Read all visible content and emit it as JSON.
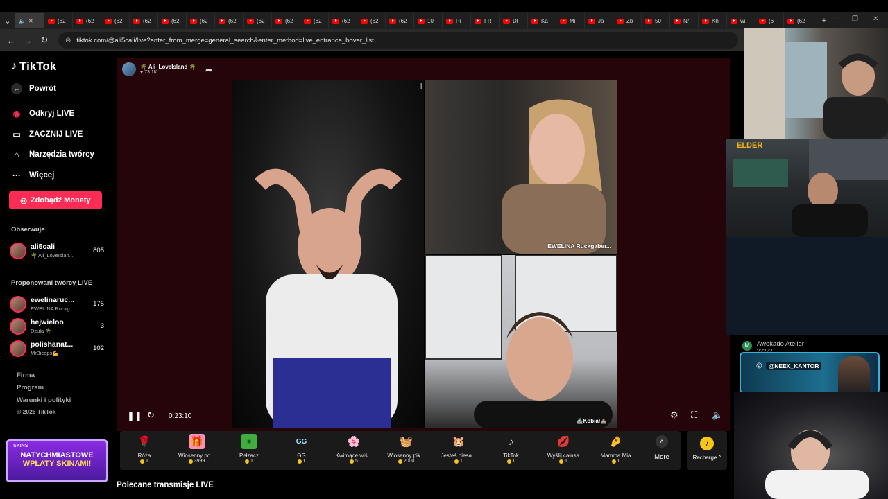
{
  "browser": {
    "tabs": [
      {
        "label": "(62",
        "type": "youtube"
      },
      {
        "label": "(62",
        "type": "youtube"
      },
      {
        "label": "(62",
        "type": "youtube"
      },
      {
        "label": "(62",
        "type": "youtube"
      },
      {
        "label": "(62",
        "type": "youtube"
      },
      {
        "label": "(62",
        "type": "youtube"
      },
      {
        "label": "(62",
        "type": "youtube"
      },
      {
        "label": "(62",
        "type": "youtube"
      },
      {
        "label": "(62",
        "type": "youtube"
      },
      {
        "label": "(62",
        "type": "youtube"
      },
      {
        "label": "(62",
        "type": "youtube"
      },
      {
        "label": "(62",
        "type": "youtube"
      },
      {
        "label": "(62",
        "type": "youtube"
      },
      {
        "label": "10",
        "type": "youtube"
      },
      {
        "label": "Pr",
        "type": "youtube"
      },
      {
        "label": "FR",
        "type": "youtube"
      },
      {
        "label": "Dl",
        "type": "youtube"
      },
      {
        "label": "Ka",
        "type": "youtube"
      },
      {
        "label": "Mi",
        "type": "youtube"
      },
      {
        "label": "Ja",
        "type": "youtube"
      },
      {
        "label": "Zb",
        "type": "youtube"
      },
      {
        "label": "50",
        "type": "youtube"
      },
      {
        "label": "N/",
        "type": "youtube"
      },
      {
        "label": "Kh",
        "type": "youtube"
      },
      {
        "label": "wi",
        "type": "youtube"
      },
      {
        "label": "(6",
        "type": "youtube"
      },
      {
        "label": "(62",
        "type": "youtube"
      }
    ],
    "url": "tiktok.com/@ali5cali/live?enter_from_merge=general_search&enter_method=live_entrance_hover_list",
    "new_tab": "+",
    "accent_tab_icon": "#ff0000"
  },
  "sidebar": {
    "logo": "TikTok",
    "back": "Powrót",
    "nav": [
      {
        "label": "Odkryj LIVE",
        "icon": "live-avatar-icon"
      },
      {
        "label": "ZACZNIJ LIVE",
        "icon": "camera-icon"
      },
      {
        "label": "Narzędzia twórcy",
        "icon": "home-icon"
      },
      {
        "label": "Więcej",
        "icon": "more-dots-icon"
      }
    ],
    "coins_button": "Zdobądź Monety",
    "following_title": "Obserwuje",
    "following": [
      {
        "name": "ali5cali",
        "sub": "🌴 Ali_LoveIslan...",
        "count": "805"
      }
    ],
    "suggested_title": "Proponowani twórcy LIVE",
    "suggested": [
      {
        "name": "ewelinaruc...",
        "sub": "EWELINA Ruckg...",
        "count": "175"
      },
      {
        "name": "hejwieloo",
        "sub": "Dzula 🌴",
        "count": "3"
      },
      {
        "name": "polishanat...",
        "sub": "MrBiceps💪",
        "count": "102"
      }
    ],
    "footer": [
      "Firma",
      "Program",
      "Warunki i polityki",
      "© 2026 TikTok"
    ],
    "accent": "#fe2c55"
  },
  "stream": {
    "host_name": "🌴 Ali_LoveIsland 🌴",
    "host_likes": "♥ 73.1K",
    "guest_top_label": "EWELINA Ruckgaber...",
    "guest_bottom_label": "🏯Kobiał🏰",
    "timer": "0:23:10"
  },
  "gifts": [
    {
      "name": "Róża",
      "price": "1",
      "icon": "🌹",
      "bg": "transparent"
    },
    {
      "name": "Wiosenny po...",
      "price": "3999",
      "icon": "🎁",
      "bg": "#ff8fb3"
    },
    {
      "name": "Pełzacz",
      "price": "1",
      "icon": "■",
      "bg": "#3fae3f"
    },
    {
      "name": "GG",
      "price": "1",
      "icon": "GG",
      "bg": "transparent"
    },
    {
      "name": "Kwitnące wiś...",
      "price": "5",
      "icon": "🌸",
      "bg": "transparent"
    },
    {
      "name": "Wiosenny pik...",
      "price": "2000",
      "icon": "🧺",
      "bg": "transparent"
    },
    {
      "name": "Jesteś niesa...",
      "price": "1",
      "icon": "🐹",
      "bg": "transparent"
    },
    {
      "name": "TikTok",
      "price": "1",
      "icon": "♪",
      "bg": "transparent"
    },
    {
      "name": "Wyślij całusa",
      "price": "1",
      "icon": "💋",
      "bg": "transparent"
    },
    {
      "name": "Mamma Mia",
      "price": "1",
      "icon": "🤌",
      "bg": "transparent"
    }
  ],
  "gift_more": "More",
  "recharge": "Recharge ^",
  "recommended": "Polecane transmisje LIVE",
  "overlays": {
    "awokado_name": "Awokado Atelier",
    "awokado_sub": "?????",
    "banner_handle": "@NEEX_KANTOR",
    "cam2_badge": "ELDER",
    "ad_brand": "SKINS",
    "ad_line1": "NATYCHMIASTOWE",
    "ad_line2": "WPŁATY SKINAMI!"
  }
}
